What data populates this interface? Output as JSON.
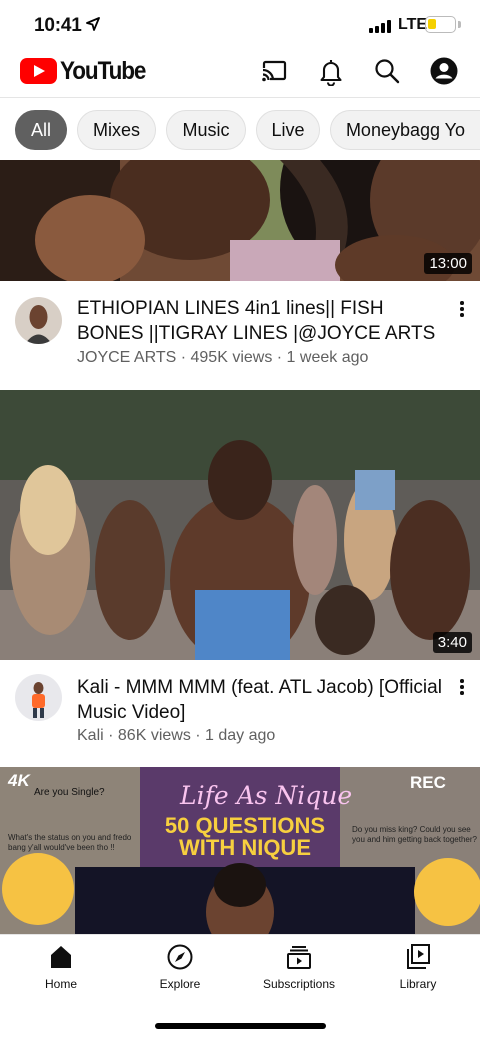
{
  "status_bar": {
    "time": "10:41",
    "network": "LTE",
    "battery_level": 0.35
  },
  "header": {
    "logo_text": "YouTube",
    "icons": [
      "cast-icon",
      "notifications-icon",
      "search-icon",
      "account-icon"
    ]
  },
  "chips": [
    {
      "label": "All",
      "active": true
    },
    {
      "label": "Mixes",
      "active": false
    },
    {
      "label": "Music",
      "active": false
    },
    {
      "label": "Live",
      "active": false
    },
    {
      "label": "Moneybagg Yo",
      "active": false
    }
  ],
  "videos": [
    {
      "duration": "13:00",
      "title": "ETHIOPIAN LINES 4in1 lines|| FISH BONES ||TIGRAY LINES |@JOYCE ARTS",
      "channel": "JOYCE ARTS",
      "meta": "JOYCE ARTS · 495K views · 1 week ago"
    },
    {
      "duration": "3:40",
      "title": "Kali - MMM MMM (feat. ATL Jacob) [Official Music Video]",
      "channel": "Kali",
      "meta": "Kali · 86K views · 1 day ago"
    },
    {
      "thumbnail_texts": [
        "4K",
        "Are you Single?",
        "Life As Nique",
        "50 QUESTIONS WITH NIQUE",
        "REC",
        "What's the status on you and fredo bang y'all would've been tho !!",
        "Do you miss king? Could you see you and him getting back together?"
      ]
    }
  ],
  "bottom_nav": [
    {
      "label": "Home",
      "icon": "home-icon",
      "active": true
    },
    {
      "label": "Explore",
      "icon": "compass-icon",
      "active": false
    },
    {
      "label": "Subscriptions",
      "icon": "subscriptions-icon",
      "active": false
    },
    {
      "label": "Library",
      "icon": "library-icon",
      "active": false
    }
  ],
  "colors": {
    "brand_red": "#ff0000",
    "active_chip": "#606060",
    "meta_text": "#606060"
  }
}
